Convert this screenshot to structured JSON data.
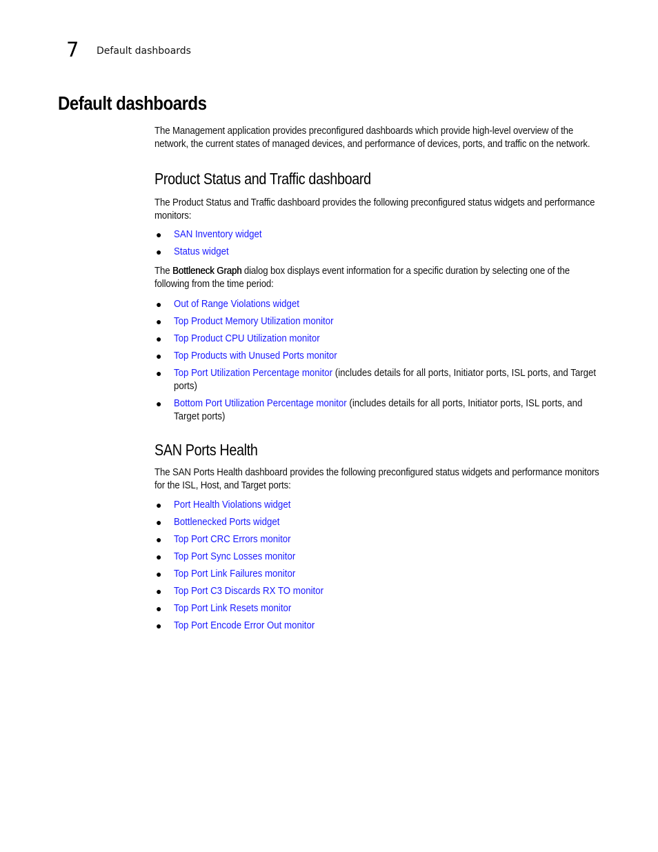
{
  "header": {
    "chapter_number": "7",
    "chapter_title": "Default dashboards"
  },
  "page_title": "Default dashboards",
  "intro": "The Management application provides preconfigured dashboards which provide high-level overview of the network, the current states of managed devices, and performance of devices, ports, and traffic on the network.",
  "sections": {
    "product_status": {
      "heading": "Product Status and Traffic dashboard",
      "intro": "The Product Status and Traffic dashboard provides the following preconfigured status widgets and performance monitors:",
      "widgets": [
        {
          "label": "SAN Inventory widget"
        },
        {
          "label": "Status widget"
        }
      ],
      "bottleneck_text": {
        "prefix": "The ",
        "bold": "Bottleneck Graph",
        "suffix": " dialog box displays event information for a specific duration by selecting one of the following from the time period:"
      },
      "monitors": [
        {
          "label": "Out of Range Violations widget",
          "note": ""
        },
        {
          "label": "Top Product Memory Utilization monitor",
          "note": ""
        },
        {
          "label": "Top Product CPU Utilization monitor",
          "note": ""
        },
        {
          "label": "Top Products with Unused Ports monitor",
          "note": ""
        },
        {
          "label": "Top Port Utilization Percentage monitor",
          "note": " (includes details for all ports, Initiator ports, ISL ports, and Target ports)"
        },
        {
          "label": "Bottom Port Utilization Percentage monitor",
          "note": " (includes details for all ports, Initiator ports, ISL ports, and Target ports)"
        }
      ]
    },
    "san_ports_health": {
      "heading": "SAN Ports Health",
      "intro": "The SAN Ports Health dashboard provides the following preconfigured status widgets and performance monitors for the ISL, Host, and Target ports:",
      "items": [
        {
          "label": "Port Health Violations widget"
        },
        {
          "label": "Bottlenecked Ports widget"
        },
        {
          "label": "Top Port CRC Errors monitor"
        },
        {
          "label": "Top Port Sync Losses monitor"
        },
        {
          "label": "Top Port Link Failures monitor"
        },
        {
          "label": "Top Port C3 Discards RX TO monitor"
        },
        {
          "label": "Top Port Link Resets monitor"
        },
        {
          "label": "Top Port Encode Error Out monitor"
        }
      ]
    }
  },
  "colors": {
    "link": "#1a1aff",
    "text": "#111111"
  }
}
